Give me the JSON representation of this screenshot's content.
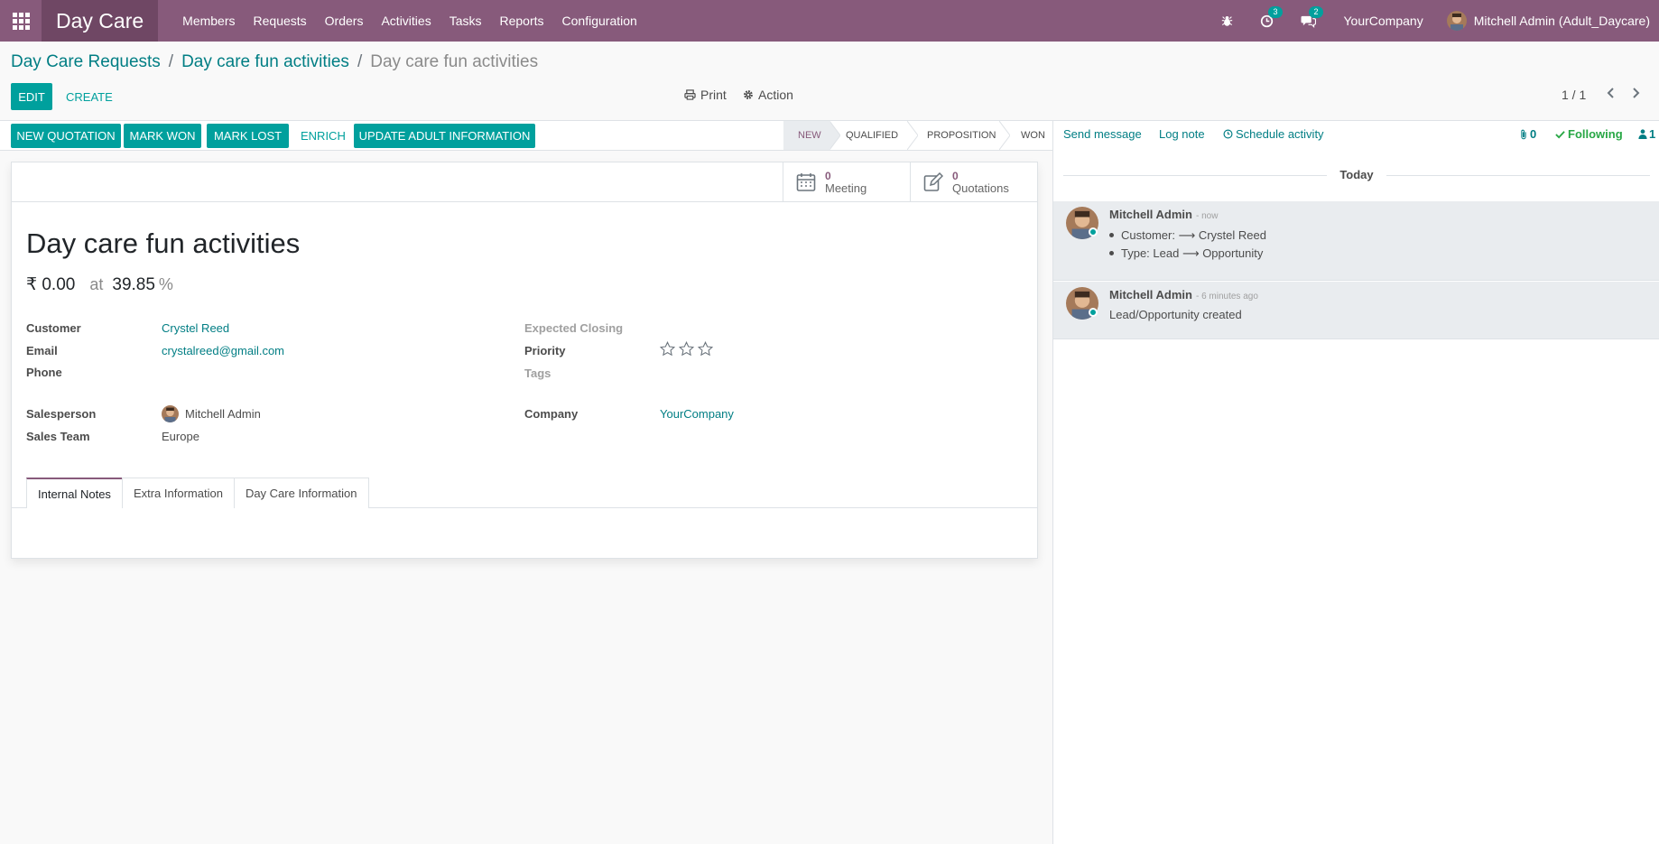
{
  "navbar": {
    "app_name": "Day Care",
    "menu": [
      "Members",
      "Requests",
      "Orders",
      "Activities",
      "Tasks",
      "Reports",
      "Configuration"
    ],
    "activity_count": "3",
    "message_count": "2",
    "company": "YourCompany",
    "user": "Mitchell Admin (Adult_Daycare)",
    "brand_color": "#875a7b",
    "accent_color": "#00a09d"
  },
  "breadcrumb": {
    "level1": "Day Care Requests",
    "level2": "Day care fun activities",
    "current": "Day care fun activities"
  },
  "control_panel": {
    "edit_label": "EDIT",
    "create_label": "CREATE",
    "print_label": "Print",
    "action_label": "Action",
    "pager": "1 / 1"
  },
  "header_buttons": {
    "new_quotation": "NEW QUOTATION",
    "mark_won": "MARK WON",
    "mark_lost": "MARK LOST",
    "enrich": "ENRICH",
    "update_adult": "UPDATE ADULT INFORMATION"
  },
  "stages": [
    "NEW",
    "QUALIFIED",
    "PROPOSITION",
    "WON"
  ],
  "active_stage": "NEW",
  "smart_buttons": {
    "meeting_value": "0",
    "meeting_label": "Meeting",
    "quotations_value": "0",
    "quotations_label": "Quotations"
  },
  "record": {
    "title": "Day care fun activities",
    "revenue": "₹ 0.00",
    "at_label": "at",
    "probability": "39.85",
    "percent_sign": "%"
  },
  "fields": {
    "customer_label": "Customer",
    "customer_value": "Crystel Reed",
    "email_label": "Email",
    "email_value": "crystalreed@gmail.com",
    "phone_label": "Phone",
    "salesperson_label": "Salesperson",
    "salesperson_value": "Mitchell Admin",
    "sales_team_label": "Sales Team",
    "sales_team_value": "Europe",
    "expected_closing_label": "Expected Closing",
    "priority_label": "Priority",
    "priority_stars": 0,
    "tags_label": "Tags",
    "company_label": "Company",
    "company_value": "YourCompany"
  },
  "tabs": [
    "Internal Notes",
    "Extra Information",
    "Day Care Information"
  ],
  "chatter": {
    "send_message": "Send message",
    "log_note": "Log note",
    "schedule_activity": "Schedule activity",
    "attachments": "0",
    "following": "Following",
    "followers": "1",
    "today_label": "Today",
    "messages": [
      {
        "author": "Mitchell Admin",
        "date": "- now",
        "lines": [
          "Customer: ⟶ Crystel Reed",
          "Type: Lead ⟶ Opportunity"
        ]
      },
      {
        "author": "Mitchell Admin",
        "date": "- 6 minutes ago",
        "lines": [
          "Lead/Opportunity created"
        ]
      }
    ]
  }
}
